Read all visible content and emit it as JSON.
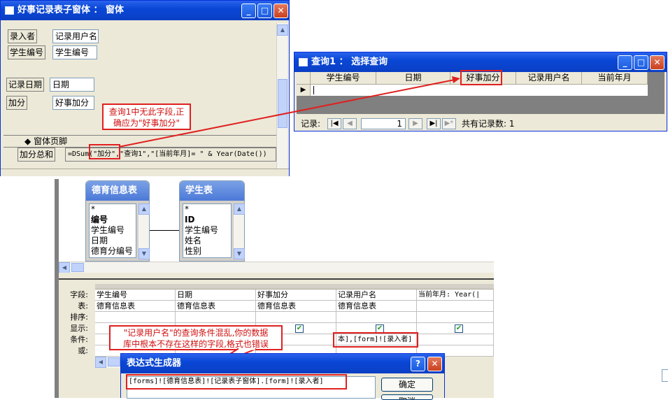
{
  "form_window": {
    "title": "好事记录表子窗体 ： 窗体",
    "labels": {
      "entry_by": "录入者",
      "student_id": "学生编号",
      "record_date": "记录日期",
      "score_add": "加分"
    },
    "fields": {
      "record_username": "记录用户名",
      "student_id": "学生编号",
      "date": "日期",
      "good_score": "好事加分"
    },
    "footer_section": "窗体页脚",
    "sum_label": "加分总和",
    "sum_formula": "=DSum(\"加分\",\"查询1\",\"[当前年月]= \" & Year(Date())"
  },
  "callout_1": {
    "line1": "查询1中无此字段,正",
    "line2": "确应为\"好事加分\""
  },
  "query_window": {
    "title": "查询1 ： 选择查询",
    "columns": [
      "学生编号",
      "日期",
      "好事加分",
      "记录用户名",
      "当前年月"
    ],
    "nav_record_label": "记录:",
    "nav_record_value": "1",
    "nav_total": "共有记录数: 1"
  },
  "design_view": {
    "tables": [
      {
        "name": "德育信息表",
        "fields": [
          "*",
          "编号",
          "学生编号",
          "日期",
          "德育分编号"
        ]
      },
      {
        "name": "学生表",
        "fields": [
          "*",
          "ID",
          "学生编号",
          "姓名",
          "性别"
        ]
      }
    ],
    "row_labels": [
      "字段:",
      "表:",
      "排序:",
      "显示:",
      "条件:",
      "或:"
    ],
    "grid": [
      {
        "field": "学生编号",
        "table": "德育信息表"
      },
      {
        "field": "日期",
        "table": "德育信息表"
      },
      {
        "field": "好事加分",
        "table": "德育信息表"
      },
      {
        "field": "记录用户名",
        "table": "德育信息表"
      },
      {
        "field": "当前年月: Year(|",
        "table": ""
      }
    ],
    "criteria_value": "本],[form]![录入者]"
  },
  "callout_2": {
    "line1": "\"记录用户名\"的查询条件混乱,你的数据",
    "line2": "库中根本不存在这样的字段,格式也错误"
  },
  "expr_builder": {
    "title": "表达式生成器",
    "expression": "[forms]![德育信息表]![记录表子窗体].[form]![录入者]",
    "ok_label": "确定",
    "cancel_label": "取消"
  },
  "colors": {
    "xp_blue": "#0a47d6",
    "annotation_red": "#e02020",
    "panel": "#ece9d8"
  }
}
